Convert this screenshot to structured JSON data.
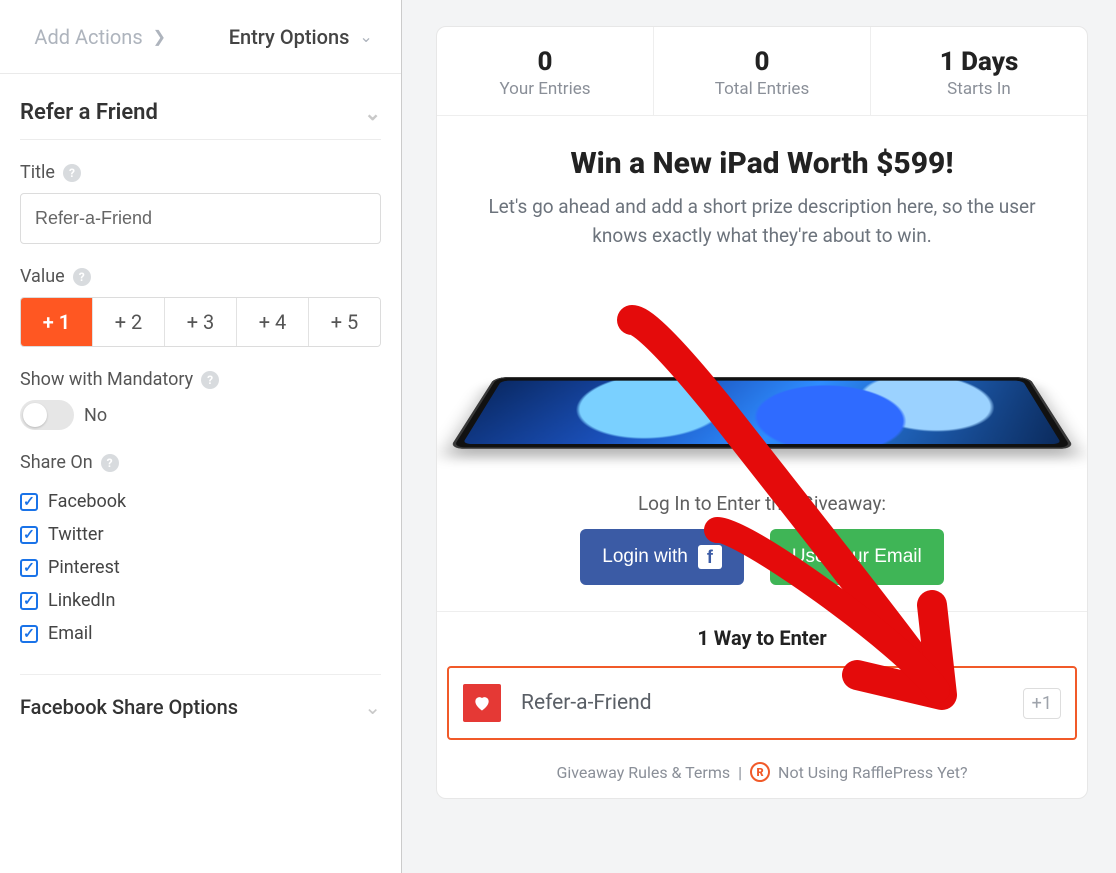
{
  "tabs": {
    "add_actions": "Add Actions",
    "entry_options": "Entry Options"
  },
  "section": {
    "refer_friend": "Refer a Friend",
    "facebook_share": "Facebook Share Options"
  },
  "fields": {
    "title_label": "Title",
    "title_value": "Refer-a-Friend",
    "value_label": "Value",
    "show_mandatory_label": "Show with Mandatory",
    "toggle_state": "No",
    "share_on_label": "Share On"
  },
  "values": {
    "v1": "+ 1",
    "v2": "+ 2",
    "v3": "+ 3",
    "v4": "+ 4",
    "v5": "+ 5"
  },
  "share": {
    "facebook": "Facebook",
    "twitter": "Twitter",
    "pinterest": "Pinterest",
    "linkedin": "LinkedIn",
    "email": "Email"
  },
  "preview": {
    "stats": {
      "your_entries_num": "0",
      "your_entries_lbl": "Your Entries",
      "total_entries_num": "0",
      "total_entries_lbl": "Total Entries",
      "starts_in_num": "1 Days",
      "starts_in_lbl": "Starts In"
    },
    "headline": "Win a New iPad Worth $599!",
    "subhead": "Let's go ahead and add a short prize description here, so the user knows exactly what they're about to win.",
    "login_prompt": "Log In to Enter this Giveaway:",
    "login_with": "Login with",
    "use_email": "Use Your Email",
    "ways_header": "1 Way to Enter",
    "entry_title": "Refer-a-Friend",
    "entry_badge": "+1",
    "footer_rules": "Giveaway Rules & Terms",
    "footer_sep": "|",
    "footer_cta": "Not Using RafflePress Yet?"
  }
}
